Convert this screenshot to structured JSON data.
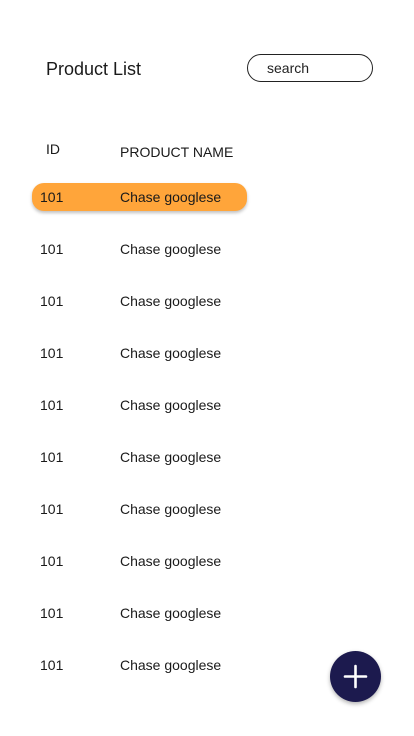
{
  "header": {
    "title": "Product List",
    "search_placeholder": "search"
  },
  "table": {
    "columns": [
      "ID",
      "PRODUCT NAME"
    ],
    "selected_index": 0,
    "rows": [
      {
        "id": "101",
        "name": "Chase googlese"
      },
      {
        "id": "101",
        "name": "Chase googlese"
      },
      {
        "id": "101",
        "name": "Chase googlese"
      },
      {
        "id": "101",
        "name": "Chase googlese"
      },
      {
        "id": "101",
        "name": "Chase googlese"
      },
      {
        "id": "101",
        "name": "Chase googlese"
      },
      {
        "id": "101",
        "name": "Chase googlese"
      },
      {
        "id": "101",
        "name": "Chase googlese"
      },
      {
        "id": "101",
        "name": "Chase googlese"
      },
      {
        "id": "101",
        "name": "Chase googlese"
      }
    ]
  },
  "fab": {
    "icon": "plus-icon"
  },
  "colors": {
    "selected_row": "#ffa53a",
    "fab_background": "#1c1a4e",
    "fab_icon": "#ffffff"
  }
}
